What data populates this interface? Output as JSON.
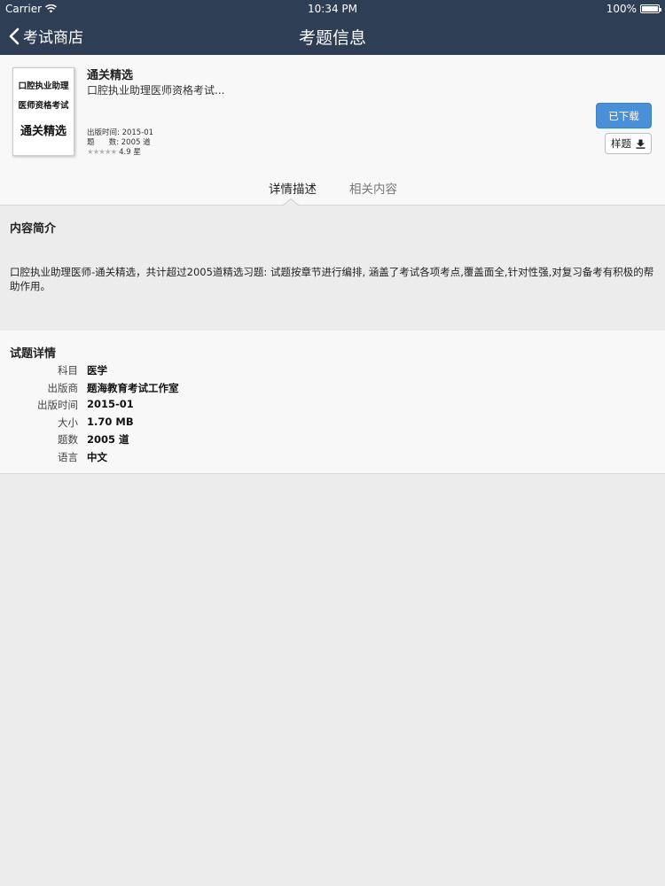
{
  "status_bar": {
    "carrier": "Carrier",
    "time": "10:34 PM",
    "battery": "100%",
    "battery_level": 1.0
  },
  "nav": {
    "back_label": "考试商店",
    "title": "考题信息"
  },
  "product": {
    "cover": {
      "line1": "口腔执业助理",
      "line2": "医师资格考试",
      "line3": "通关精选"
    },
    "title": "通关精选",
    "subtitle": "口腔执业助理医师资格考试...",
    "publish_date": "出版时间: 2015-01",
    "question_count": "题      数: 2005 道",
    "stars": "★★★★★",
    "rating": "4.9 星",
    "downloaded_label": "已下载",
    "sample_label": "样题"
  },
  "tabs": [
    {
      "label": "详情描述",
      "active": true
    },
    {
      "label": "相关内容",
      "active": false
    }
  ],
  "intro": {
    "title": "内容简介",
    "body": "口腔执业助理医师-通关精选，共计超过2005道精选习题: 试题按章节进行编排, 涵盖了考试各项考点,覆盖面全,针对性强,对复习备考有积极的帮助作用。"
  },
  "details": {
    "title": "试题详情",
    "rows": [
      {
        "key": "科目",
        "value": "医学"
      },
      {
        "key": "出版商",
        "value": "题海教育考试工作室"
      },
      {
        "key": "出版时间",
        "value": "2015-01"
      },
      {
        "key": "大小",
        "value": "1.70 MB"
      },
      {
        "key": "题数",
        "value": "2005 道"
      },
      {
        "key": "语言",
        "value": "中文"
      }
    ]
  },
  "colors": {
    "nav_bg": "#2e3e55",
    "accent": "#4a90d9",
    "page_bg": "#ececec",
    "card_bg": "#f8f8f8"
  }
}
